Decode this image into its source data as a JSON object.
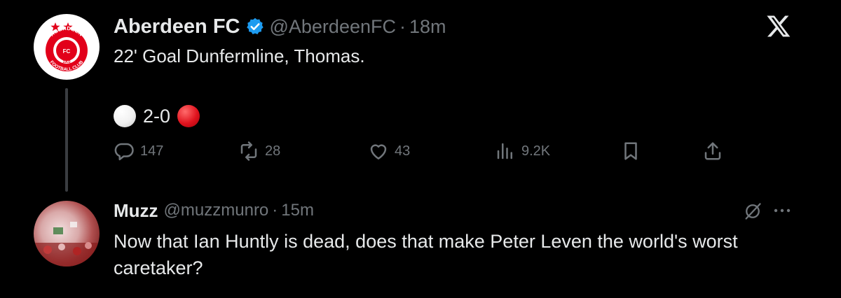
{
  "tweet": {
    "author_name": "Aberdeen FC",
    "handle": "@AberdeenFC",
    "separator": "·",
    "time": "18m",
    "line1": "22' Goal Dunfermline, Thomas.",
    "score": "2-0",
    "avatar_text": {
      "top": "ABERDEEN",
      "bottom": "FOOTBALL CLUB",
      "year": "1903",
      "badge": "FC"
    },
    "actions": {
      "reply_count": "147",
      "repost_count": "28",
      "like_count": "43",
      "views_count": "9.2K"
    },
    "colors": {
      "verified": "#1d9bf0",
      "crest_red": "#e2001a"
    }
  },
  "reply": {
    "author_name": "Muzz",
    "handle": "@muzzmunro",
    "separator": "·",
    "time": "15m",
    "text": "Now that Ian Huntly is dead, does that make Peter Leven the world's worst caretaker?"
  },
  "icons": {
    "app_logo": "x-logo-icon",
    "reply": "reply-icon",
    "repost": "repost-icon",
    "like": "heart-icon",
    "views": "views-icon",
    "bookmark": "bookmark-icon",
    "share": "share-icon",
    "grok": "grok-icon",
    "more": "more-icon"
  }
}
